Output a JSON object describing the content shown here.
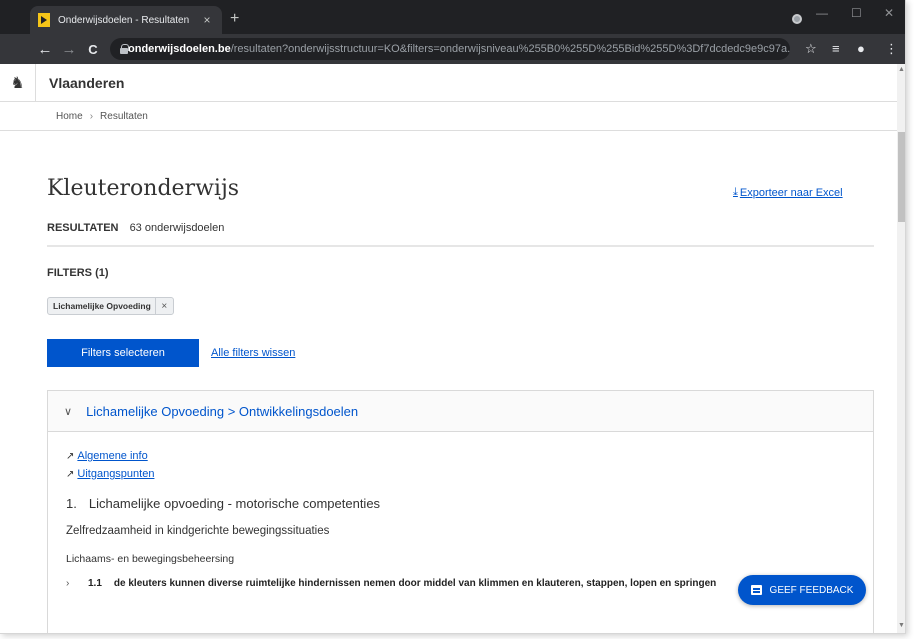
{
  "browser": {
    "tab_title": "Onderwijsdoelen - Resultaten",
    "tab_close": "×",
    "new_tab": "+",
    "url_host": "onderwijsdoelen.be",
    "url_rest": "/resultaten?onderwijsstructuur=KO&filters=onderwijsniveau%255B0%255D%255Bid%255D%3Df7dcdedc9e9c97a..."
  },
  "header": {
    "site_name": "Vlaanderen"
  },
  "breadcrumb": {
    "home": "Home",
    "separator": "›",
    "current": "Resultaten"
  },
  "page": {
    "title": "Kleuteronderwijs",
    "export_label": "Exporteer naar Excel",
    "results_label": "RESULTATEN",
    "results_count": "63 onderwijsdoelen",
    "filters_label": "FILTERS (1)",
    "filter_chip": "Lichamelijke Opvoeding",
    "filter_chip_close": "×",
    "select_filters_button": "Filters selecteren",
    "clear_filters_link": "Alle filters wissen"
  },
  "accordion": {
    "title": "Lichamelijke Opvoeding > Ontwikkelingsdoelen",
    "links": [
      "Algemene info",
      "Uitgangspunten"
    ],
    "section_number": "1.",
    "section_title": "Lichamelijke opvoeding - motorische competenties",
    "subsection_title": "Zelfredzaamheid in kindgerichte bewegingssituaties",
    "group_label": "Lichaams- en bewegingsbeheersing",
    "goal_number": "1.1",
    "goal_text": "de kleuters kunnen diverse ruimtelijke hindernissen nemen door middel van klimmen en klauteren, stappen, lopen en springen"
  },
  "feedback": {
    "label": "GEEF FEEDBACK"
  },
  "colors": {
    "accent": "#0055cc",
    "chrome_dark": "#202124",
    "chrome_toolbar": "#35363a"
  }
}
